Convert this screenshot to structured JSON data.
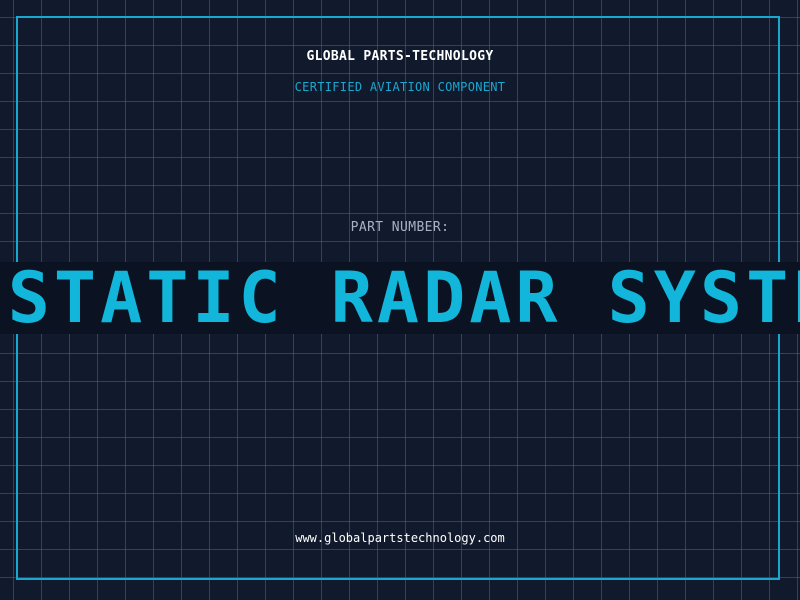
{
  "header": {
    "company": "GLOBAL PARTS-TECHNOLOGY",
    "subtitle": "CERTIFIED AVIATION COMPONENT"
  },
  "part": {
    "label": "PART NUMBER:",
    "value": "BISTATIC RADAR SYSTEM"
  },
  "footer": {
    "url": "www.globalpartstechnology.com"
  },
  "colors": {
    "background": "#111a2c",
    "grid": "#2a708c",
    "accent": "#1ba6cf",
    "band": "#0b1322",
    "text": "#ffffff"
  }
}
